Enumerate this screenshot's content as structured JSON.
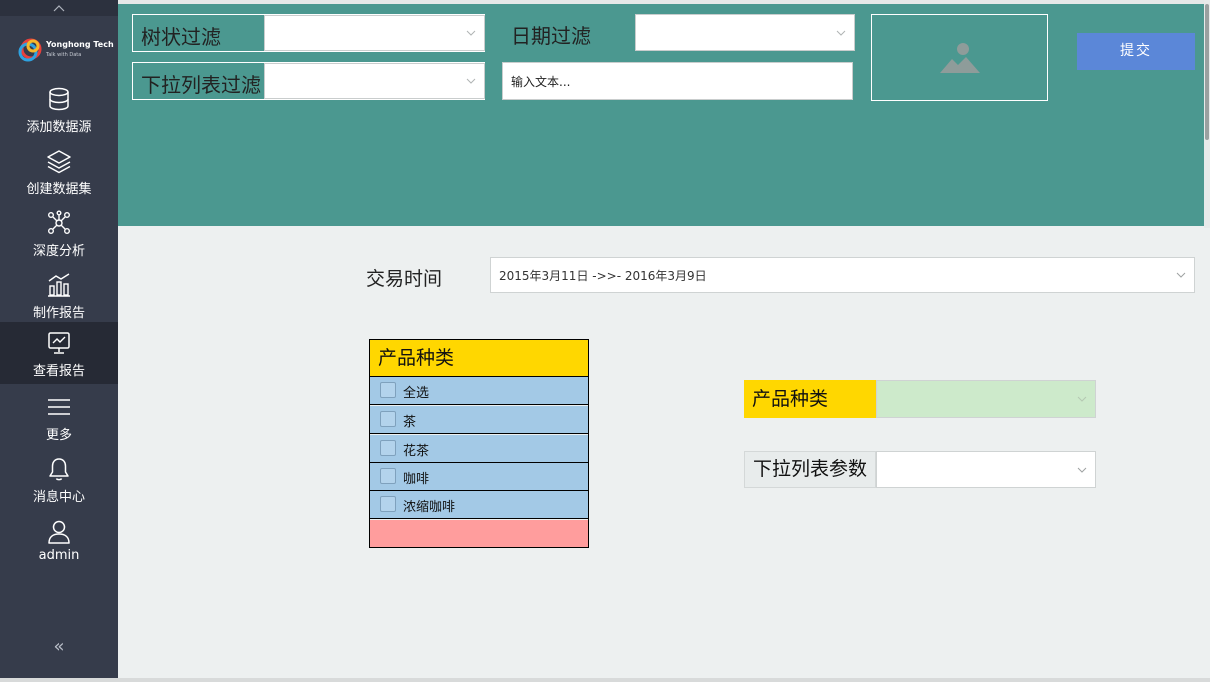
{
  "sidebar": {
    "logo": {
      "name": "Yonghong Tech",
      "tagline": "Talk with Data"
    },
    "items": [
      {
        "label": "添加数据源",
        "icon": "database-icon"
      },
      {
        "label": "创建数据集",
        "icon": "layers-icon"
      },
      {
        "label": "深度分析",
        "icon": "network-icon"
      },
      {
        "label": "制作报告",
        "icon": "bar-chart-icon"
      },
      {
        "label": "查看报告",
        "icon": "monitor-icon",
        "active": true
      },
      {
        "label": "更多",
        "icon": "menu-icon"
      },
      {
        "label": "消息中心",
        "icon": "bell-icon"
      },
      {
        "label": "admin",
        "icon": "user-icon"
      }
    ],
    "collapse_glyph": "«"
  },
  "filters": {
    "tree_label": "树状过滤",
    "date_label": "日期过滤",
    "dropdown_label": "下拉列表过滤",
    "text_input_placeholder": "输入文本...",
    "submit_label": "提交"
  },
  "report": {
    "trade_time_label": "交易时间",
    "date_range_value": "2015年3月11日 ->>- 2016年3月9日",
    "checklist": {
      "header": "产品种类",
      "items": [
        "全选",
        "茶",
        "花茶",
        "咖啡",
        "浓缩咖啡"
      ]
    },
    "category_label": "产品种类",
    "param_label": "下拉列表参数"
  },
  "colors": {
    "sidebar_bg": "#363c4b",
    "panel_teal": "#4b9890",
    "submit_blue": "#5b87d8",
    "header_yellow": "#ffd700",
    "row_blue": "#a3c9e6",
    "footer_pink": "#ff9d9d",
    "select_green": "#cdeacb"
  }
}
